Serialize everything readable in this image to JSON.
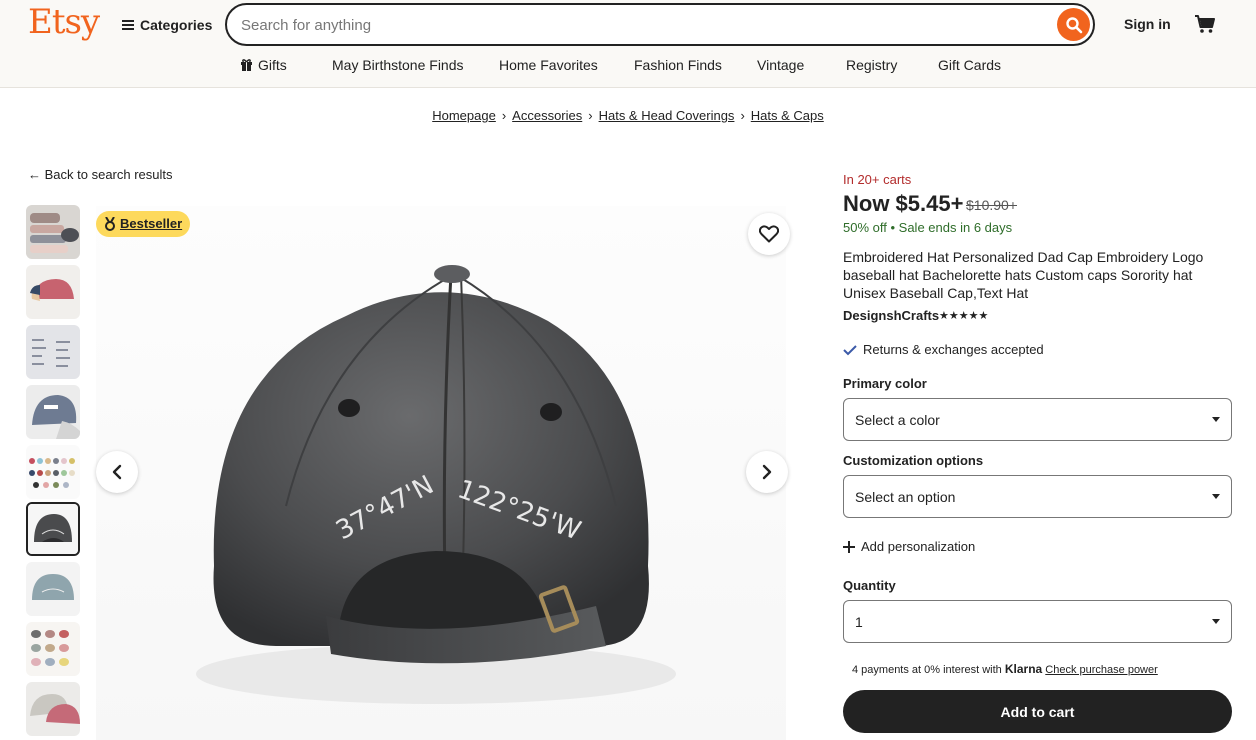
{
  "header": {
    "logo": "Etsy",
    "categories_label": "Categories",
    "search_placeholder": "Search for anything",
    "signin_label": "Sign in"
  },
  "subnav": [
    "Gifts",
    "May Birthstone Finds",
    "Home Favorites",
    "Fashion Finds",
    "Vintage",
    "Registry",
    "Gift Cards"
  ],
  "breadcrumb": [
    "Homepage",
    "Accessories",
    "Hats & Head Coverings",
    "Hats & Caps"
  ],
  "back_label": "Back to search results",
  "bestseller_label": "Bestseller",
  "image_text": {
    "left_coord": "37°47'N",
    "right_coord": "122°25'W"
  },
  "product": {
    "carts_text": "In 20+ carts",
    "price": "Now $5.45+",
    "old_price": "$10.90+",
    "discount": "50% off",
    "sale_ends": "Sale ends in 6 days",
    "title": "Embroidered Hat Personalized Dad Cap Embroidery Logo baseball hat Bachelorette hats Custom caps Sorority hat Unisex Baseball Cap,Text Hat",
    "shop_name": "DesignshCrafts",
    "stars": "★★★★★",
    "returns": "Returns & exchanges accepted"
  },
  "options": {
    "primary_color_label": "Primary color",
    "primary_color_value": "Select a color",
    "customization_label": "Customization options",
    "customization_value": "Select an option",
    "add_personalization": "Add personalization",
    "quantity_label": "Quantity",
    "quantity_value": "1"
  },
  "klarna": {
    "text": "4 payments at 0% interest with",
    "brand": "Klarna",
    "link": "Check purchase power"
  },
  "add_to_cart": "Add to cart",
  "colors": {
    "brand": "#f1641e",
    "sale_green": "#2f6d2a",
    "carts_red": "#b32c2c",
    "bestseller_yellow": "#fdd95c"
  }
}
